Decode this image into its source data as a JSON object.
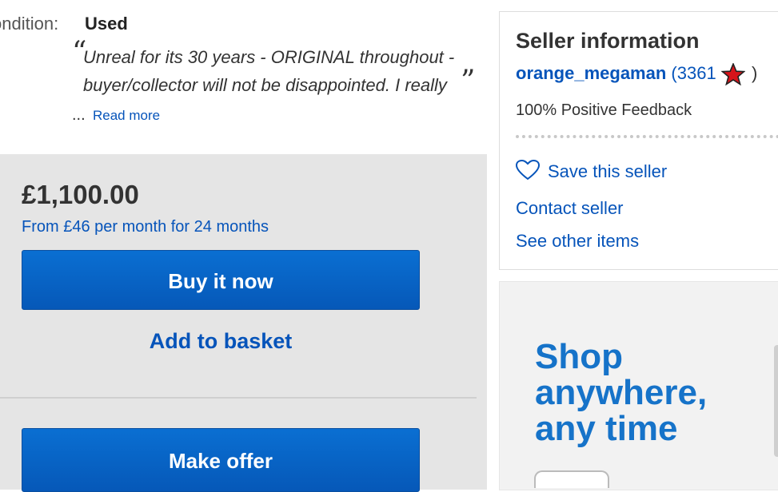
{
  "item": {
    "condition_label": "ondition:",
    "condition_value": "Used",
    "description_lines": [
      "Unreal for its 30 years - ORIGINAL throughout -",
      "buyer/collector will not be disappointed. I really"
    ],
    "ellipsis": "...",
    "read_more": "Read more"
  },
  "purchase": {
    "price": "£1,100.00",
    "finance_text": "From £46 per month for 24 months",
    "buy_now_label": "Buy it now",
    "add_to_basket_label": "Add to basket",
    "make_offer_label": "Make offer"
  },
  "seller": {
    "title": "Seller information",
    "username": "orange_megaman",
    "feedback_score": "(3361",
    "close_paren": ")",
    "positive_feedback": "100% Positive Feedback",
    "save_seller_label": "Save this seller",
    "contact_seller_label": "Contact seller",
    "other_items_label": "See other items",
    "star_icon": "red-star-icon"
  },
  "ad": {
    "lines": [
      "Shop",
      "anywhere,",
      "any time"
    ]
  },
  "colors": {
    "link_blue": "#0654ba",
    "button_blue": "#0a6fd2",
    "price_box_bg": "#e5e5e5",
    "ad_blue": "#1673c9"
  }
}
